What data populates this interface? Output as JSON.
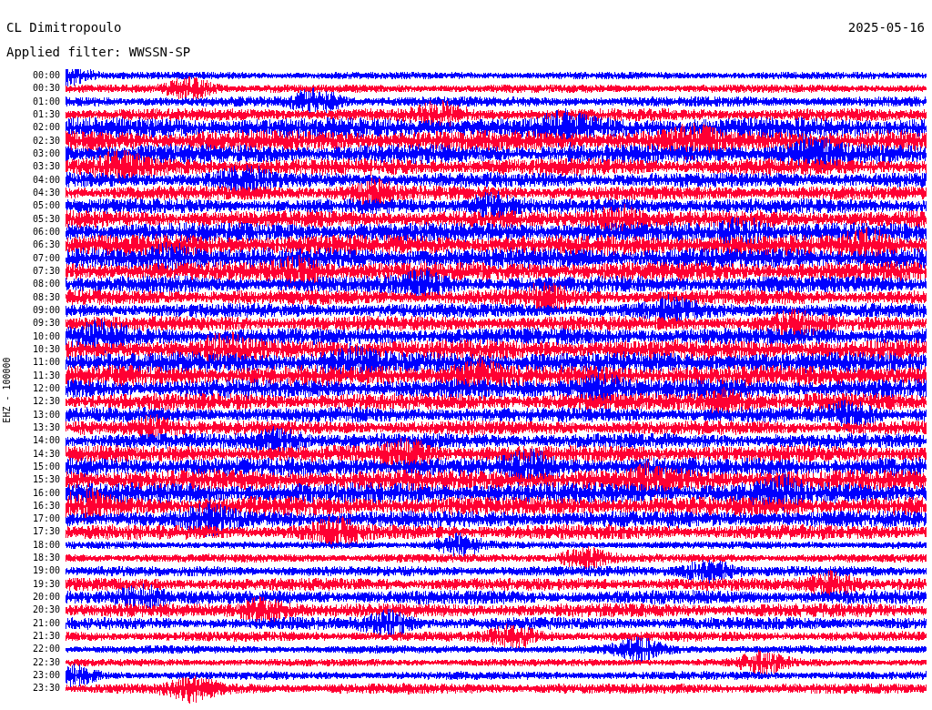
{
  "header": {
    "station": "CL Dimitropoulo",
    "date": "2025-05-16",
    "filter": "Applied filter: WWSSN-SP"
  },
  "axis_label": "EHZ - 100000",
  "rows": [
    {
      "label": "00:00",
      "color": "#0000ff"
    },
    {
      "label": "00:30",
      "color": "#ff0033"
    },
    {
      "label": "01:00",
      "color": "#0000ff"
    },
    {
      "label": "01:30",
      "color": "#ff0033"
    },
    {
      "label": "02:00",
      "color": "#0000ff"
    },
    {
      "label": "02:30",
      "color": "#ff0033"
    },
    {
      "label": "03:00",
      "color": "#0000ff"
    },
    {
      "label": "03:30",
      "color": "#ff0033"
    },
    {
      "label": "04:00",
      "color": "#0000ff"
    },
    {
      "label": "04:30",
      "color": "#ff0033"
    },
    {
      "label": "05:00",
      "color": "#0000ff"
    },
    {
      "label": "05:30",
      "color": "#ff0033"
    },
    {
      "label": "06:00",
      "color": "#0000ff"
    },
    {
      "label": "06:30",
      "color": "#ff0033"
    },
    {
      "label": "07:00",
      "color": "#0000ff"
    },
    {
      "label": "07:30",
      "color": "#ff0033"
    },
    {
      "label": "08:00",
      "color": "#0000ff"
    },
    {
      "label": "08:30",
      "color": "#ff0033"
    },
    {
      "label": "09:00",
      "color": "#0000ff"
    },
    {
      "label": "09:30",
      "color": "#ff0033"
    },
    {
      "label": "10:00",
      "color": "#0000ff"
    },
    {
      "label": "10:30",
      "color": "#ff0033"
    },
    {
      "label": "11:00",
      "color": "#0000ff"
    },
    {
      "label": "11:30",
      "color": "#ff0033"
    },
    {
      "label": "12:00",
      "color": "#0000ff"
    },
    {
      "label": "12:30",
      "color": "#ff0033"
    },
    {
      "label": "13:00",
      "color": "#0000ff"
    },
    {
      "label": "13:30",
      "color": "#ff0033"
    },
    {
      "label": "14:00",
      "color": "#0000ff"
    },
    {
      "label": "14:30",
      "color": "#ff0033"
    },
    {
      "label": "15:00",
      "color": "#0000ff"
    },
    {
      "label": "15:30",
      "color": "#ff0033"
    },
    {
      "label": "16:00",
      "color": "#0000ff"
    },
    {
      "label": "16:30",
      "color": "#ff0033"
    },
    {
      "label": "17:00",
      "color": "#0000ff"
    },
    {
      "label": "17:30",
      "color": "#ff0033"
    },
    {
      "label": "18:00",
      "color": "#0000ff"
    },
    {
      "label": "18:30",
      "color": "#ff0033"
    },
    {
      "label": "19:00",
      "color": "#0000ff"
    },
    {
      "label": "19:30",
      "color": "#ff0033"
    },
    {
      "label": "20:00",
      "color": "#0000ff"
    },
    {
      "label": "20:30",
      "color": "#ff0033"
    },
    {
      "label": "21:00",
      "color": "#0000ff"
    },
    {
      "label": "21:30",
      "color": "#ff0033"
    },
    {
      "label": "22:00",
      "color": "#0000ff"
    },
    {
      "label": "22:30",
      "color": "#ff0033"
    },
    {
      "label": "23:00",
      "color": "#0000ff"
    },
    {
      "label": "23:30",
      "color": "#ff0033"
    }
  ]
}
